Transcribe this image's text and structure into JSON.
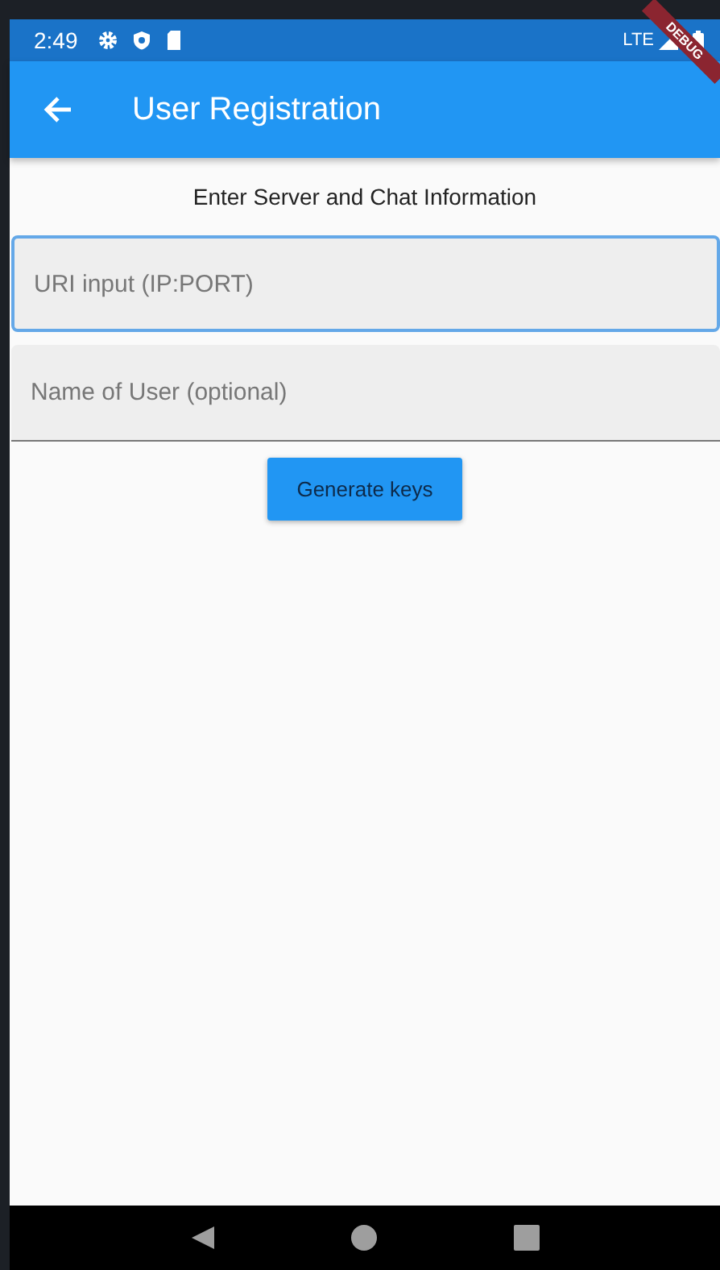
{
  "status_bar": {
    "time": "2:49",
    "network": "LTE"
  },
  "app_bar": {
    "title": "User Registration"
  },
  "debug_banner": "DEBUG",
  "heading": "Enter Server and Chat Information",
  "fields": [
    {
      "placeholder": "URI input (IP:PORT)",
      "focused": true
    },
    {
      "placeholder": "Name of User (optional)",
      "focused": false
    }
  ],
  "button": "Generate keys"
}
